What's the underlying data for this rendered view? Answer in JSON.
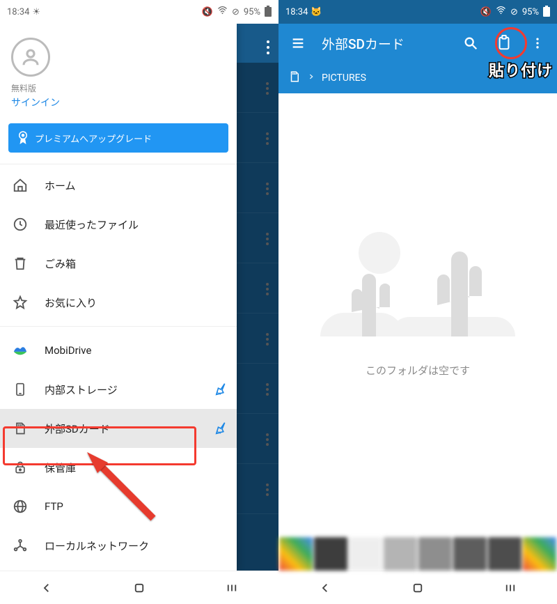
{
  "status": {
    "time": "18:34",
    "battery": "95%"
  },
  "left": {
    "plan_label": "無料版",
    "signin_label": "サインイン",
    "premium_label": "プレミアムへアップグレード",
    "menu": [
      {
        "label": "ホーム"
      },
      {
        "label": "最近使ったファイル"
      },
      {
        "label": "ごみ箱"
      },
      {
        "label": "お気に入り"
      }
    ],
    "storage": [
      {
        "label": "MobiDrive"
      },
      {
        "label": "内部ストレージ"
      },
      {
        "label": "外部SDカード"
      },
      {
        "label": "保管庫"
      },
      {
        "label": "FTP"
      },
      {
        "label": "ローカルネットワーク"
      }
    ]
  },
  "right": {
    "title": "外部SDカード",
    "breadcrumb": "PICTURES",
    "empty_text": "このフォルダは空です",
    "annotation_paste": "貼り付け"
  }
}
